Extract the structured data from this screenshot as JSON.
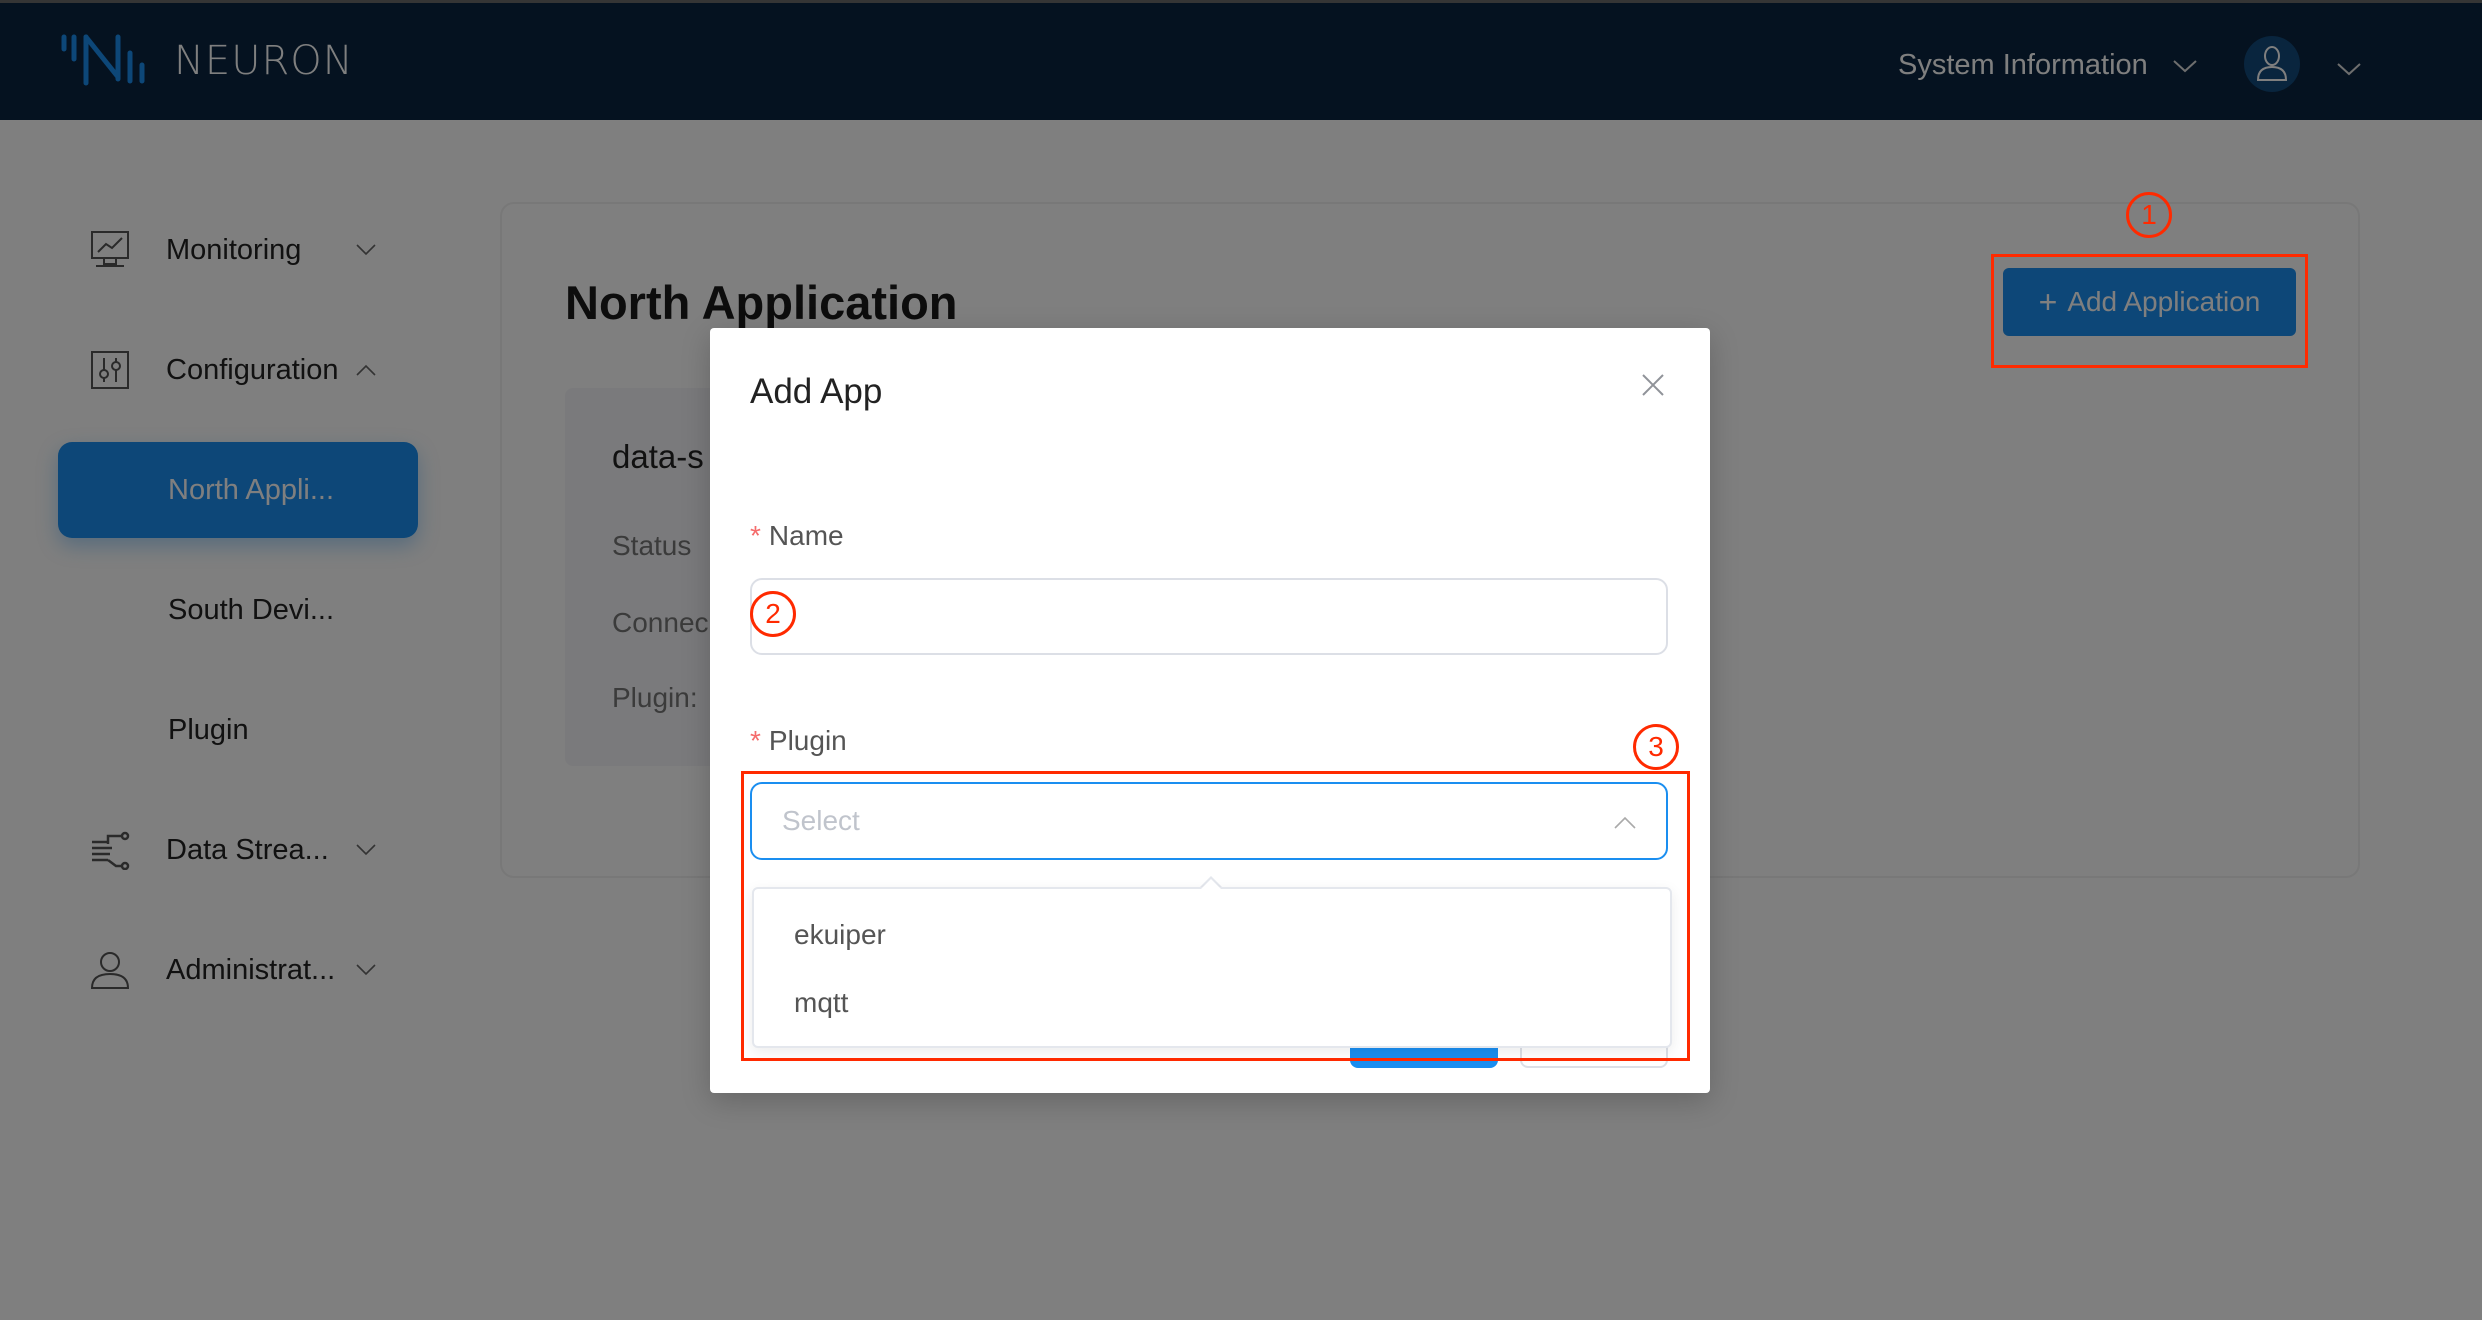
{
  "header": {
    "brand": "NEURON",
    "system_info_label": "System Information",
    "logo_icon": "neuron-logo",
    "user_icon": "user-avatar-icon",
    "colors": {
      "background": "#0a2540",
      "logo_accent": "#1a8ef0"
    }
  },
  "sidebar": {
    "items": [
      {
        "label": "Monitoring",
        "icon": "monitor-chart-icon",
        "expanded": false
      },
      {
        "label": "Configuration",
        "icon": "sliders-icon",
        "expanded": true
      },
      {
        "label": "North Appli...",
        "active": true
      },
      {
        "label": "South Devi..."
      },
      {
        "label": "Plugin"
      },
      {
        "label": "Data Strea...",
        "icon": "data-stream-icon",
        "expanded": false
      },
      {
        "label": "Administrat...",
        "icon": "user-icon",
        "expanded": false
      }
    ],
    "active_color": "#1a8ef0"
  },
  "main": {
    "title": "North Application",
    "add_button_label": "Add Application",
    "node_card": {
      "name": "data-s",
      "fields": [
        "Status",
        "Connec",
        "Plugin:"
      ]
    }
  },
  "modal": {
    "title": "Add App",
    "name_label": "Name",
    "name_value": "",
    "plugin_label": "Plugin",
    "plugin_placeholder": "Select",
    "required_marker": "*",
    "plugin_options": [
      "ekuiper",
      "mqtt"
    ]
  },
  "annotations": {
    "step1": "1",
    "step2": "2",
    "step3": "3",
    "color": "#ff2a00"
  }
}
